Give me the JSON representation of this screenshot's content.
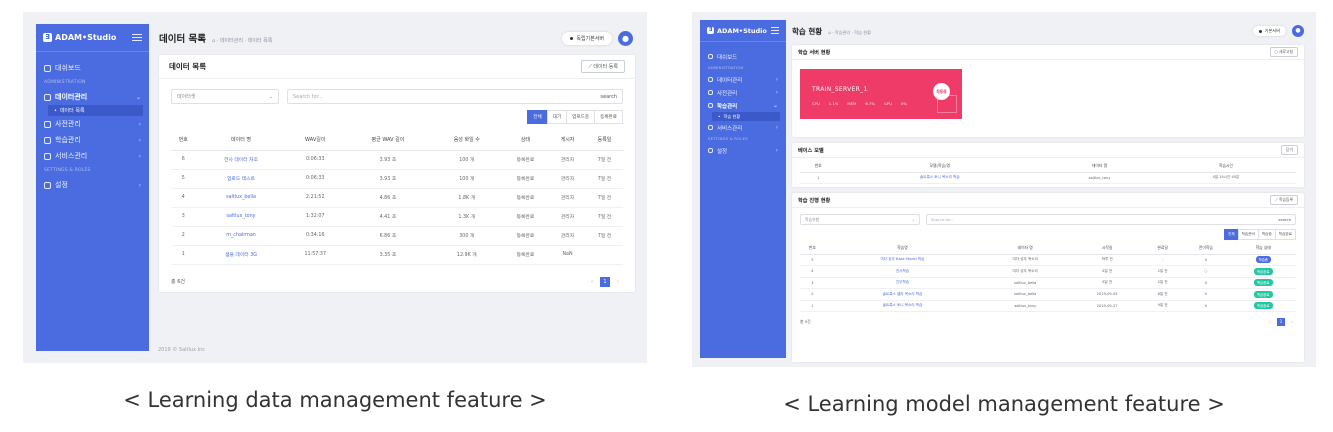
{
  "screenshot1": {
    "brand": "ADAM•Studio",
    "sidebar": [
      {
        "type": "item",
        "label": "대쉬보드"
      },
      {
        "type": "section",
        "label": "ADMINISTRATION"
      },
      {
        "type": "item",
        "label": "데이터관리",
        "active": true
      },
      {
        "type": "sub",
        "label": "데이터 목록"
      },
      {
        "type": "item",
        "label": "사전관리"
      },
      {
        "type": "item",
        "label": "학습관리"
      },
      {
        "type": "item",
        "label": "서비스관리"
      },
      {
        "type": "section",
        "label": "SETTINGS & ROLES"
      },
      {
        "type": "item",
        "label": "설정"
      }
    ],
    "page_title": "데이터 목록",
    "breadcrumb": "⌂ · 데이터관리 · 데이터 목록",
    "status_pill": "독립기본서버",
    "card_title": "데이터 목록",
    "register_button": "⟋ 데이터 등록",
    "select_placeholder": "데이터셋",
    "search_placeholder": "Search for...",
    "search_button": "search",
    "tabs": [
      {
        "label": "전체",
        "active": true
      },
      {
        "label": "대기"
      },
      {
        "label": "업로드중"
      },
      {
        "label": "등록완료"
      }
    ],
    "columns": [
      "번호",
      "데이터 명",
      "WAV길이",
      "평균 WAV 길이",
      "음성 화일 수",
      "상태",
      "게시자",
      "등록일"
    ],
    "rows": [
      [
        "6",
        "전사 데이터 처조",
        "0:06:33",
        "3.93 초",
        "100 개",
        "등록완료",
        "관리자",
        "7일 전"
      ],
      [
        "5",
        "업로드 테스트",
        "0:06:33",
        "3.93 초",
        "100 개",
        "등록완료",
        "관리자",
        "7일 전"
      ],
      [
        "4",
        "saltlux_bella",
        "2:21:52",
        "4.86 초",
        "1.8K 개",
        "등록완료",
        "관리자",
        "7일 전"
      ],
      [
        "3",
        "saltlux_tony",
        "1:32:07",
        "4.41 초",
        "1.3K 개",
        "등록완료",
        "관리자",
        "7일 전"
      ],
      [
        "2",
        "m_chairman",
        "0:34:16",
        "6.86 초",
        "300 개",
        "등록완료",
        "관리자",
        "7일 전"
      ],
      [
        "1",
        "샘플 데이터 3G",
        "11:57:37",
        "3.35 초",
        "12.9K 개",
        "등록완료",
        "NaN"
      ]
    ],
    "total": "총 6건",
    "page": "1",
    "footer": "2019 © Saltlux Inc"
  },
  "screenshot2": {
    "brand": "ADAM•Studio",
    "sidebar": [
      {
        "type": "item",
        "label": "대쉬보드"
      },
      {
        "type": "section",
        "label": "ADMINISTRATION"
      },
      {
        "type": "item",
        "label": "데이터관리"
      },
      {
        "type": "item",
        "label": "사전관리"
      },
      {
        "type": "item",
        "label": "학습관리",
        "active": true
      },
      {
        "type": "sub",
        "label": "학습 현황"
      },
      {
        "type": "item",
        "label": "서비스관리"
      },
      {
        "type": "section",
        "label": "SETTINGS & ROLES"
      },
      {
        "type": "item",
        "label": "설정"
      }
    ],
    "page_title": "학습 현황",
    "breadcrumb": "⌂ · 학습관리 · 학습 현황",
    "status_pill": "기본서버",
    "server_card_title": "학습 서버 현황",
    "server_card_button": "○ 새로고침",
    "server": {
      "name": "TRAIN_SERVER_1",
      "stats": [
        "CPU",
        "1.1%",
        "MEM",
        "6.7%",
        "GPU",
        "0%"
      ],
      "badge": "작동중"
    },
    "base_model_title": "베이스 모델",
    "base_model_button": "닫기",
    "base_columns": [
      "번호",
      "모델(학습)명",
      "데이터 명",
      "학습시간"
    ],
    "base_rows": [
      [
        "1",
        "솔트룩스 토니 목소리 학습",
        "saltlux_tony",
        "4일 14시간 40분"
      ]
    ],
    "progress_title": "학습 진행 현황",
    "progress_button": "⟋ 학습등록",
    "select_placeholder": "학습유형",
    "search_placeholder": "Search for...",
    "search_button": "search",
    "tabs": [
      {
        "label": "전체",
        "active": true
      },
      {
        "label": "학습준비"
      },
      {
        "label": "학습중"
      },
      {
        "label": "학습완료"
      }
    ],
    "columns": [
      "번호",
      "학습명",
      "데이터 명",
      "시작일",
      "완료일",
      "전이학습",
      "학습 상태"
    ],
    "rows": [
      {
        "no": "5",
        "name": "여자 성우 Base Model 학습",
        "data": "여자 성우 목소리",
        "start": "하루 전",
        "end": "-",
        "transfer": "✕",
        "status": "학습중",
        "state": "running"
      },
      {
        "no": "4",
        "name": "전사학습",
        "data": "여자 성우 목소리",
        "start": "4일 전",
        "end": "2일 전",
        "transfer": "○",
        "status": "학습완료",
        "state": "done"
      },
      {
        "no": "3",
        "name": "진우학습",
        "data": "saltlux_bella",
        "start": "5일 전",
        "end": "2일 전",
        "transfer": "✕",
        "status": "학습완료",
        "state": "done"
      },
      {
        "no": "2",
        "name": "솔트룩스 벨라 목소리 학습",
        "data": "saltlux_bella",
        "start": "2019-09-05",
        "end": "8일 전",
        "transfer": "✕",
        "status": "학습완료",
        "state": "done"
      },
      {
        "no": "1",
        "name": "솔트룩스 토니 목소리 학습",
        "data": "saltlux_tony",
        "start": "2019-09-27",
        "end": "9일 전",
        "transfer": "✕",
        "status": "학습완료",
        "state": "done"
      }
    ],
    "total": "총 5건",
    "page": "1"
  },
  "captions": {
    "left": "< Learning data management feature >",
    "right": "< Learning model management feature >"
  },
  "colors": {
    "sidebar": "#4a6ce0",
    "server_card": "#ef3b67",
    "done_badge": "#26c6a2"
  }
}
